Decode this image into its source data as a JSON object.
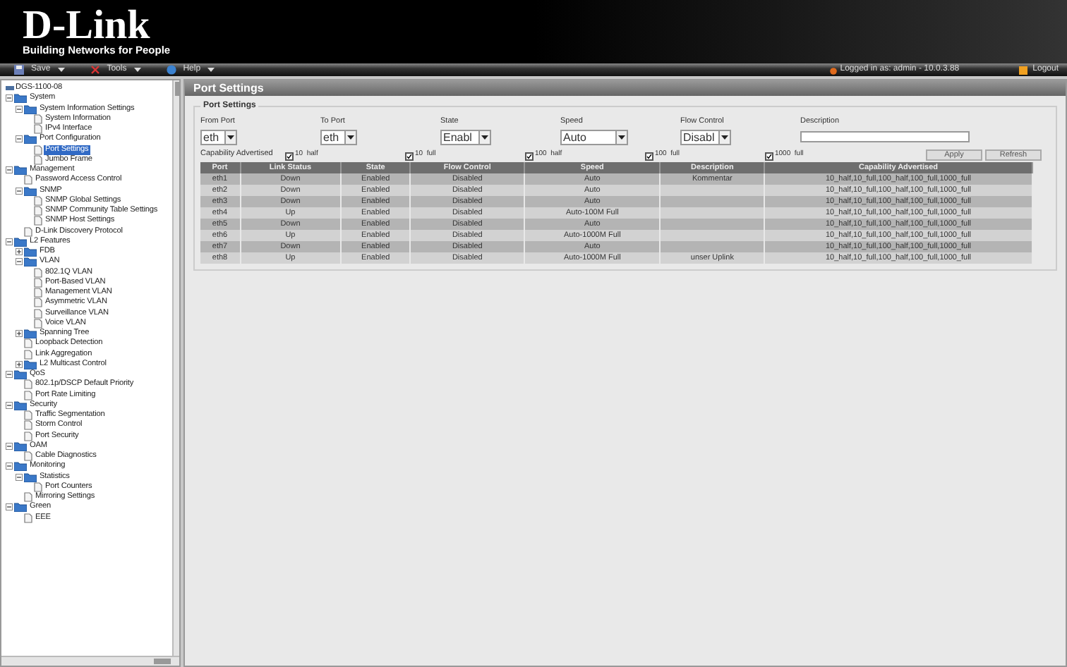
{
  "header": {
    "logo": "D-Link",
    "tagline": "Building Networks for People"
  },
  "menu": {
    "items": [
      {
        "label": "Save",
        "kind": "save"
      },
      {
        "label": "Tools",
        "kind": "tools"
      },
      {
        "label": "Help",
        "kind": "help"
      }
    ],
    "login": "Logged in as: admin - 10.0.3.88",
    "logout": "Logout"
  },
  "tree": {
    "root": "DGS-1100-08",
    "items": [
      {
        "label": "System",
        "kind": "folder",
        "expanded": true,
        "selected": false,
        "children": [
          {
            "label": "System Information Settings",
            "kind": "folder",
            "expanded": true,
            "selected": false,
            "children": [
              {
                "label": "System Information",
                "kind": "page",
                "selected": false
              },
              {
                "label": "IPv4 Interface",
                "kind": "page",
                "selected": false
              }
            ]
          },
          {
            "label": "Port Configuration",
            "kind": "folder",
            "expanded": true,
            "selected": false,
            "children": [
              {
                "label": "Port Settings",
                "kind": "page",
                "selected": true
              },
              {
                "label": "Jumbo Frame",
                "kind": "page",
                "selected": false
              }
            ]
          }
        ]
      },
      {
        "label": "Management",
        "kind": "folder",
        "expanded": true,
        "selected": false,
        "children": [
          {
            "label": "Password Access Control",
            "kind": "page",
            "selected": false
          },
          {
            "label": "SNMP",
            "kind": "folder",
            "expanded": true,
            "selected": false,
            "children": [
              {
                "label": "SNMP Global Settings",
                "kind": "page",
                "selected": false
              },
              {
                "label": "SNMP Community Table Settings",
                "kind": "page",
                "selected": false
              },
              {
                "label": "SNMP Host Settings",
                "kind": "page",
                "selected": false
              }
            ]
          },
          {
            "label": "D-Link Discovery Protocol",
            "kind": "page",
            "selected": false
          }
        ]
      },
      {
        "label": "L2 Features",
        "kind": "folder",
        "expanded": true,
        "selected": false,
        "children": [
          {
            "label": "FDB",
            "kind": "folder",
            "expanded": false,
            "selected": false
          },
          {
            "label": "VLAN",
            "kind": "folder",
            "expanded": true,
            "selected": false,
            "children": [
              {
                "label": "802.1Q VLAN",
                "kind": "page",
                "selected": false
              },
              {
                "label": "Port-Based VLAN",
                "kind": "page",
                "selected": false
              },
              {
                "label": "Management VLAN",
                "kind": "page",
                "selected": false
              },
              {
                "label": "Asymmetric VLAN",
                "kind": "page",
                "selected": false
              },
              {
                "label": "Surveillance VLAN",
                "kind": "page",
                "selected": false
              },
              {
                "label": "Voice VLAN",
                "kind": "page",
                "selected": false
              }
            ]
          },
          {
            "label": "Spanning Tree",
            "kind": "folder",
            "expanded": false,
            "selected": false
          },
          {
            "label": "Loopback Detection",
            "kind": "page",
            "selected": false
          },
          {
            "label": "Link Aggregation",
            "kind": "page",
            "selected": false
          },
          {
            "label": "L2 Multicast Control",
            "kind": "folder",
            "expanded": false,
            "selected": false
          }
        ]
      },
      {
        "label": "QoS",
        "kind": "folder",
        "expanded": true,
        "selected": false,
        "children": [
          {
            "label": "802.1p/DSCP Default Priority",
            "kind": "page",
            "selected": false
          },
          {
            "label": "Port Rate Limiting",
            "kind": "page",
            "selected": false
          }
        ]
      },
      {
        "label": "Security",
        "kind": "folder",
        "expanded": true,
        "selected": false,
        "children": [
          {
            "label": "Traffic Segmentation",
            "kind": "page",
            "selected": false
          },
          {
            "label": "Storm Control",
            "kind": "page",
            "selected": false
          },
          {
            "label": "Port Security",
            "kind": "page",
            "selected": false
          }
        ]
      },
      {
        "label": "OAM",
        "kind": "folder",
        "expanded": true,
        "selected": false,
        "children": [
          {
            "label": "Cable Diagnostics",
            "kind": "page",
            "selected": false
          }
        ]
      },
      {
        "label": "Monitoring",
        "kind": "folder",
        "expanded": true,
        "selected": false,
        "children": [
          {
            "label": "Statistics",
            "kind": "folder",
            "expanded": true,
            "selected": false,
            "children": [
              {
                "label": "Port Counters",
                "kind": "page",
                "selected": false
              }
            ]
          },
          {
            "label": "Mirroring Settings",
            "kind": "page",
            "selected": false
          }
        ]
      },
      {
        "label": "Green",
        "kind": "folder",
        "expanded": true,
        "selected": false,
        "children": [
          {
            "label": "EEE",
            "kind": "page",
            "selected": false
          }
        ]
      }
    ]
  },
  "page_title": "Port Settings",
  "form": {
    "legend": "Port Settings",
    "fields": [
      {
        "label": "From Port",
        "kind": "select",
        "value": "eth"
      },
      {
        "label": "To Port",
        "kind": "select",
        "value": "eth"
      },
      {
        "label": "State",
        "kind": "select",
        "value": "Enabl"
      },
      {
        "label": "Speed",
        "kind": "select",
        "value": "Auto"
      },
      {
        "label": "Flow Control",
        "kind": "select",
        "value": "Disabl"
      },
      {
        "label": "Description",
        "kind": "text"
      }
    ],
    "capability_label": "Capability Advertised",
    "capabilities": [
      {
        "label": "10  half",
        "checked": true
      },
      {
        "label": "10  full",
        "checked": true
      },
      {
        "label": "100  half",
        "checked": true
      },
      {
        "label": "100  full",
        "checked": true
      },
      {
        "label": "1000  full",
        "checked": true
      }
    ],
    "buttons": [
      "Apply",
      "Refresh"
    ]
  },
  "table": {
    "columns": [
      "Port",
      "Link Status",
      "State",
      "Flow Control",
      "Speed",
      "Description",
      "Capability Advertised"
    ],
    "rows": [
      [
        "eth1",
        "Down",
        "Enabled",
        "Disabled",
        "Auto",
        "Kommentar",
        "10_half,10_full,100_half,100_full,1000_full"
      ],
      [
        "eth2",
        "Down",
        "Enabled",
        "Disabled",
        "Auto",
        "",
        "10_half,10_full,100_half,100_full,1000_full"
      ],
      [
        "eth3",
        "Down",
        "Enabled",
        "Disabled",
        "Auto",
        "",
        "10_half,10_full,100_half,100_full,1000_full"
      ],
      [
        "eth4",
        "Up",
        "Enabled",
        "Disabled",
        "Auto-100M Full",
        "",
        "10_half,10_full,100_half,100_full,1000_full"
      ],
      [
        "eth5",
        "Down",
        "Enabled",
        "Disabled",
        "Auto",
        "",
        "10_half,10_full,100_half,100_full,1000_full"
      ],
      [
        "eth6",
        "Up",
        "Enabled",
        "Disabled",
        "Auto-1000M Full",
        "",
        "10_half,10_full,100_half,100_full,1000_full"
      ],
      [
        "eth7",
        "Down",
        "Enabled",
        "Disabled",
        "Auto",
        "",
        "10_half,10_full,100_half,100_full,1000_full"
      ],
      [
        "eth8",
        "Up",
        "Enabled",
        "Disabled",
        "Auto-1000M Full",
        "unser Uplink",
        "10_half,10_full,100_half,100_full,1000_full"
      ]
    ]
  }
}
